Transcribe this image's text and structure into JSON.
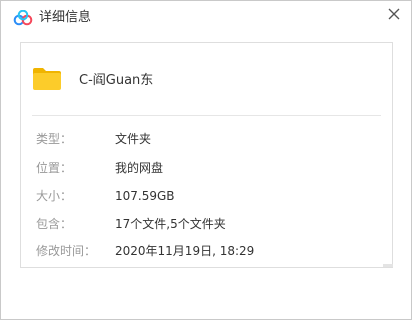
{
  "dialog": {
    "title": "详细信息",
    "close_icon": "close-icon",
    "logo_icon": "baidu-netdisk-logo-icon",
    "accent_color": "#0f7cf0"
  },
  "item": {
    "name": "C-阎Guan东",
    "icon": "folder-icon",
    "icon_color": "#f9c629"
  },
  "details": [
    {
      "label": "类型：",
      "value": "文件夹"
    },
    {
      "label": "位置：",
      "value": "我的网盘"
    },
    {
      "label": "大小：",
      "value": "107.59GB"
    },
    {
      "label": "包含：",
      "value": "17个文件,5个文件夹"
    },
    {
      "label": "修改时间：",
      "value": "2020年11月19日, 18:29"
    }
  ]
}
